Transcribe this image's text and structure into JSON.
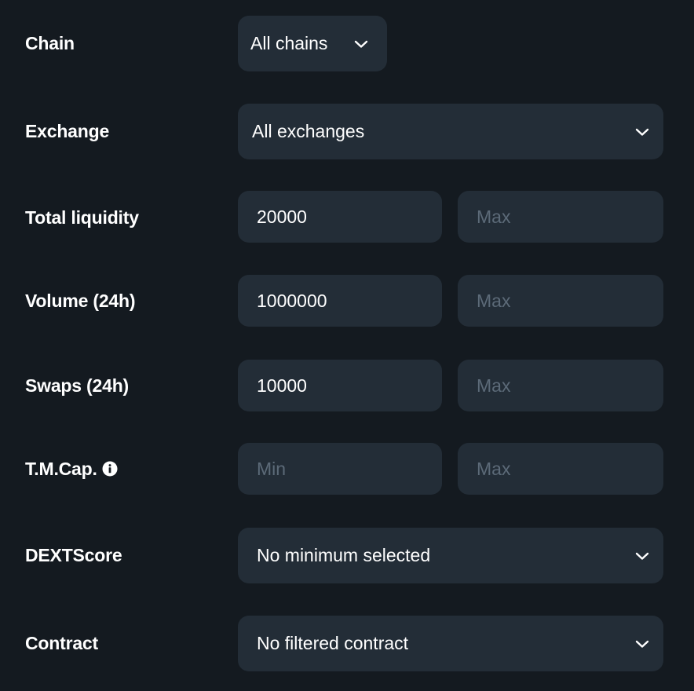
{
  "filters": {
    "chain": {
      "label": "Chain",
      "value": "All chains",
      "icon": "chevron-down-icon"
    },
    "exchange": {
      "label": "Exchange",
      "value": "All exchanges",
      "icon": "chevron-down-icon"
    },
    "total_liquidity": {
      "label": "Total liquidity",
      "min_value": "20000",
      "max_placeholder": "Max"
    },
    "volume": {
      "label": "Volume (24h)",
      "min_value": "1000000",
      "max_placeholder": "Max"
    },
    "swaps": {
      "label": "Swaps (24h)",
      "min_value": "10000",
      "max_placeholder": "Max"
    },
    "tmcap": {
      "label": "T.M.Cap.",
      "info_icon": "info-icon",
      "min_placeholder": "Min",
      "max_placeholder": "Max"
    },
    "dextscore": {
      "label": "DEXTScore",
      "value": "No minimum selected",
      "icon": "chevron-down-icon"
    },
    "contract": {
      "label": "Contract",
      "value": "No filtered contract",
      "icon": "chevron-down-icon"
    }
  },
  "colors": {
    "background": "#141a20",
    "field": "#232d37",
    "text": "#ffffff",
    "placeholder": "#5c6a78"
  }
}
